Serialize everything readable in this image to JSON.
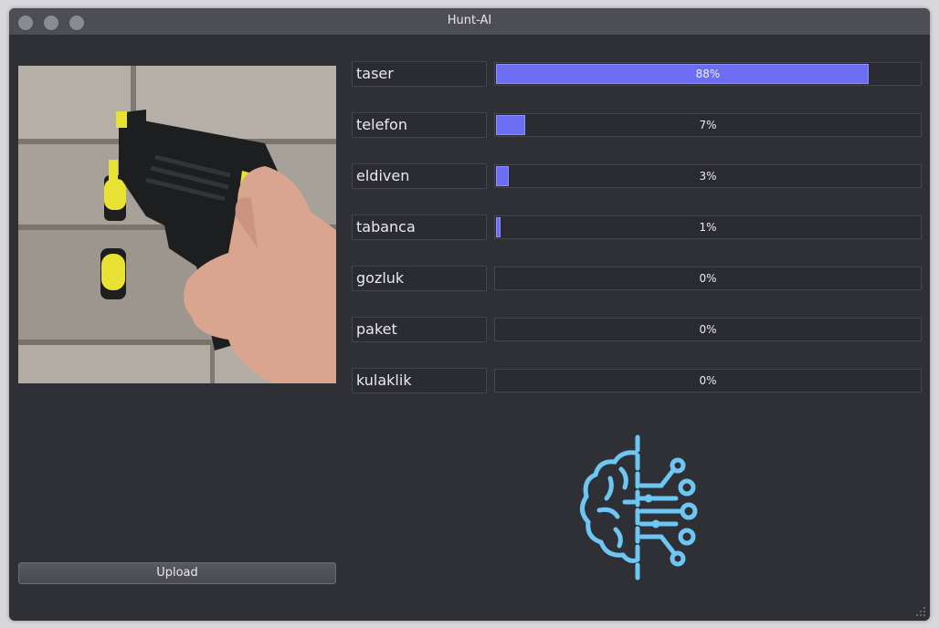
{
  "window": {
    "title": "Hunt-AI"
  },
  "image": {
    "alt": "taser image",
    "description_icon": "taser-photo"
  },
  "upload": {
    "label": "Upload"
  },
  "predictions": [
    {
      "label": "taser",
      "percent_text": "88%",
      "value": 0.88
    },
    {
      "label": "telefon",
      "percent_text": "7%",
      "value": 0.07
    },
    {
      "label": "eldiven",
      "percent_text": "3%",
      "value": 0.03
    },
    {
      "label": "tabanca",
      "percent_text": "1%",
      "value": 0.01
    },
    {
      "label": "gozluk",
      "percent_text": "0%",
      "value": 0.0
    },
    {
      "label": "paket",
      "percent_text": "0%",
      "value": 0.0
    },
    {
      "label": "kulaklik",
      "percent_text": "0%",
      "value": 0.0
    }
  ],
  "colors": {
    "accent": "#6b6ef3",
    "logo": "#6ec7f2"
  },
  "icons": {
    "logo": "ai-brain-icon"
  }
}
